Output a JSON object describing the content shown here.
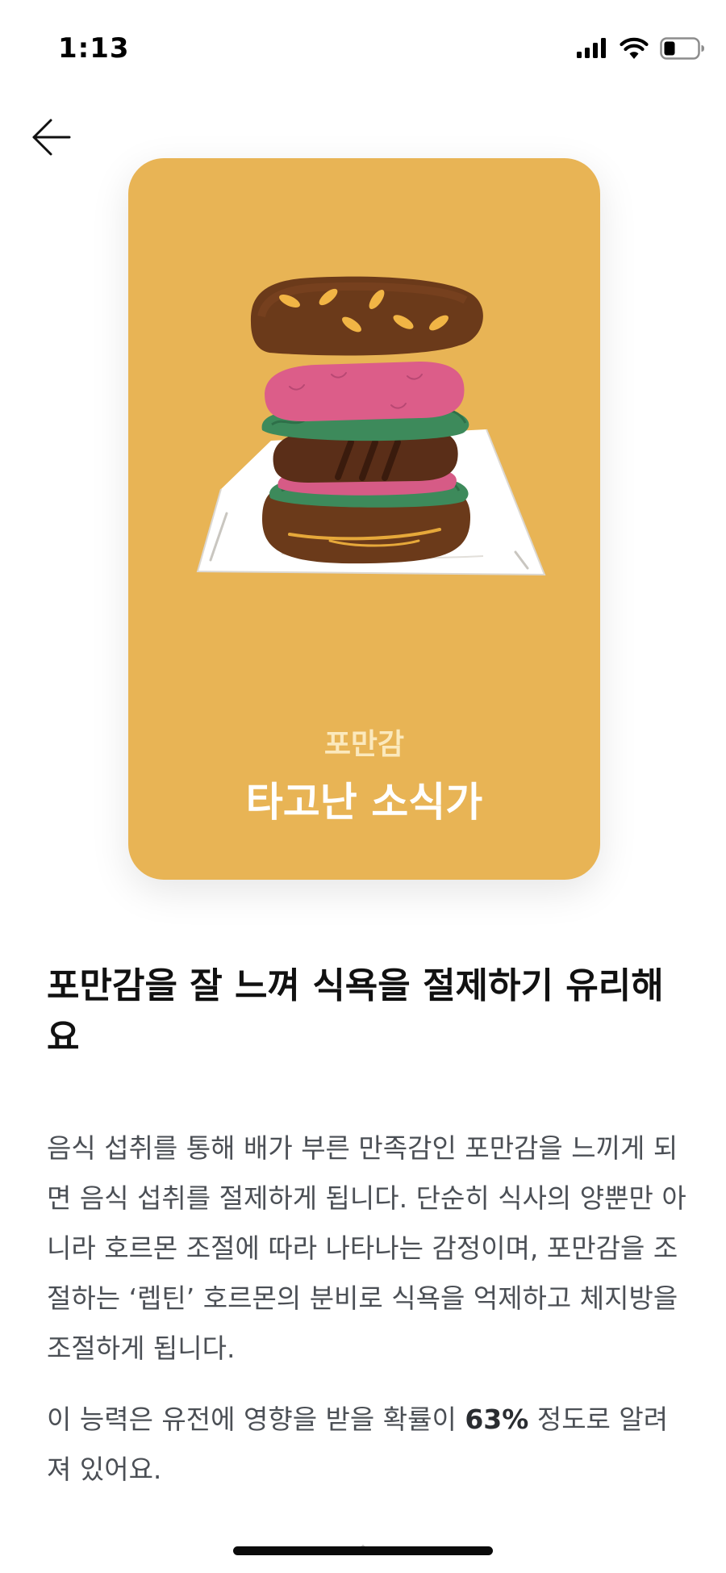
{
  "status_bar": {
    "time": "1:13",
    "icons": [
      "signal-icon",
      "wifi-icon",
      "battery-icon"
    ]
  },
  "nav": {
    "back_icon": "arrow-left-icon"
  },
  "card": {
    "background_color": "#e8b455",
    "illustration": "burger-icon",
    "subtitle": "포만감",
    "title": "타고난 소식가"
  },
  "headline": "포만감을 잘 느껴 식욕을 절제하기 유리해요",
  "description": "음식 섭취를 통해 배가 부른 만족감인 포만감을 느끼게 되면 음식 섭취를 절제하게 됩니다. 단순히 식사의 양뿐만 아니라 호르몬 조절에 따라 나타나는 감정이며, 포만감을 조절하는 ‘렙틴’ 호르몬의 분비로 식욕을 억제하고 체지방을 조절하게 됩니다.",
  "heritability": {
    "prefix": "이 능력은 유전에 영향을 받을 확률이 ",
    "value": "63%",
    "suffix": " 정도로 알려져 있어요."
  }
}
